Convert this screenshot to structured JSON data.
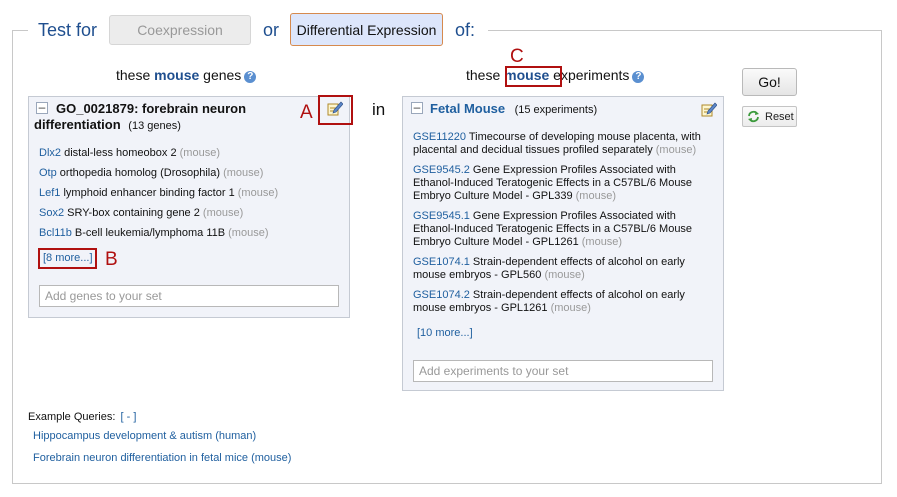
{
  "header": {
    "prefix": "Test for",
    "coexpression_label": "Coexpression",
    "or_label": "or",
    "differential_label": "Differential Expression",
    "suffix": "of:"
  },
  "gene_section": {
    "heading_pre": "these ",
    "heading_kw": "mouse",
    "heading_post": " genes",
    "help": "?",
    "panel": {
      "title": "GO_0021879: forebrain neuron differentiation",
      "title_line1": "GO_0021879: forebrain neuron",
      "title_line2": "differentiation",
      "count": "(13 genes)",
      "genes": [
        {
          "symbol": "Dlx2",
          "desc": " distal-less homeobox 2 ",
          "taxon": "(mouse)"
        },
        {
          "symbol": "Otp",
          "desc": " orthopedia homolog (Drosophila) ",
          "taxon": "(mouse)"
        },
        {
          "symbol": "Lef1",
          "desc": " lymphoid enhancer binding factor 1 ",
          "taxon": "(mouse)"
        },
        {
          "symbol": "Sox2",
          "desc": " SRY-box containing gene 2 ",
          "taxon": "(mouse)"
        },
        {
          "symbol": "Bcl11b",
          "desc": " B-cell leukemia/lymphoma 11B ",
          "taxon": "(mouse)"
        }
      ],
      "more": "[8 more...]",
      "add_placeholder": "Add genes to your set"
    }
  },
  "in_label": "in",
  "experiment_section": {
    "heading_pre": "these ",
    "heading_kw": "mouse",
    "heading_post": " experiments",
    "help": "?",
    "panel": {
      "title": "Fetal Mouse",
      "count": "(15 experiments)",
      "experiments": [
        {
          "id": "GSE11220",
          "line1": " Timecourse of developing mouse placenta, with",
          "line2": "placental and decidual tissues profiled separately ",
          "line3": "",
          "taxon": "(mouse)"
        },
        {
          "id": "GSE9545.2",
          "line1": " Gene Expression Profiles Associated with",
          "line2": "Ethanol-Induced Teratogenic Effects in a C57BL/6 Mouse",
          "line3": "Embryo Culture Model - GPL339 ",
          "taxon": "(mouse)"
        },
        {
          "id": "GSE9545.1",
          "line1": " Gene Expression Profiles Associated with",
          "line2": "Ethanol-Induced Teratogenic Effects in a C57BL/6 Mouse",
          "line3": "Embryo Culture Model - GPL1261 ",
          "taxon": "(mouse)"
        },
        {
          "id": "GSE1074.1",
          "line1": " Strain-dependent effects of alcohol on early",
          "line2": "mouse embryos - GPL560 ",
          "line3": "",
          "taxon": "(mouse)"
        },
        {
          "id": "GSE1074.2",
          "line1": " Strain-dependent effects of alcohol on early",
          "line2": "mouse embryos - GPL1261 ",
          "line3": "",
          "taxon": "(mouse)"
        }
      ],
      "more": "[10 more...]",
      "add_placeholder": "Add experiments to your set"
    }
  },
  "buttons": {
    "go": "Go!",
    "reset": "Reset"
  },
  "annotations": {
    "a": "A",
    "b": "B",
    "c": "C"
  },
  "examples": {
    "label": "Example Queries:",
    "toggle": "[ - ]",
    "items": [
      "Hippocampus development & autism (human)",
      "Forebrain neuron differentiation in fetal mice (mouse)"
    ]
  },
  "colors": {
    "accent": "#1f4f8f",
    "link": "#1f5f9f",
    "annotation_red": "#b01010",
    "panel_bg": "#f1f3f9"
  }
}
